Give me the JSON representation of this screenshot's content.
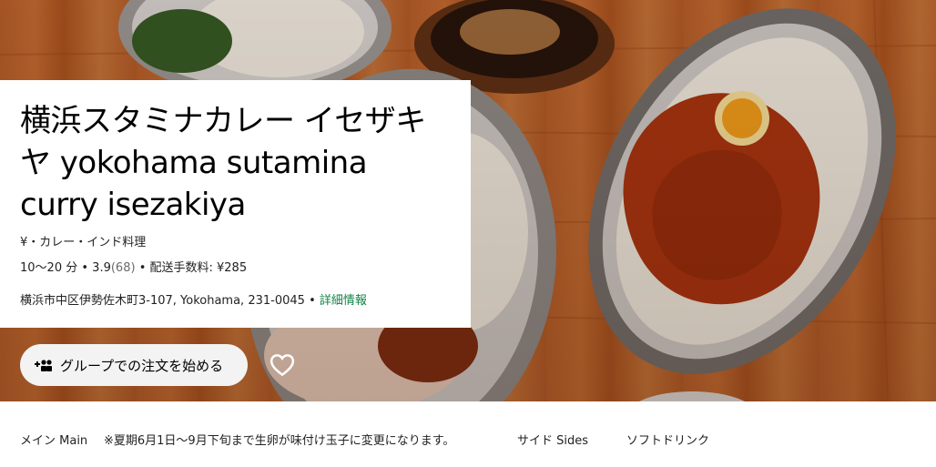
{
  "store": {
    "title": "横浜スタミナカレー イセザキヤ yokohama sutamina curry isezakiya",
    "cuisine": "¥・カレー・インド料理",
    "delivery_time": "10〜20 分",
    "separator": "•",
    "rating": "3.9",
    "rating_count": "(68)",
    "delivery_fee": "配送手数料: ¥285",
    "address": "横浜市中区伊勢佐木町3-107, Yokohama, 231-0045",
    "more_info": "詳細情報"
  },
  "actions": {
    "group_order_label": "グループでの注文を始める",
    "group_icon": "group-add-icon",
    "favorite_icon": "heart-outline-icon"
  },
  "category_tabs": [
    {
      "label": "メイン Main"
    },
    {
      "label": "※夏期6月1日〜9月下旬まで生卵が味付け玉子に変更になります。"
    },
    {
      "label": "サイド Sides"
    },
    {
      "label": "ソフトドリンク"
    }
  ]
}
